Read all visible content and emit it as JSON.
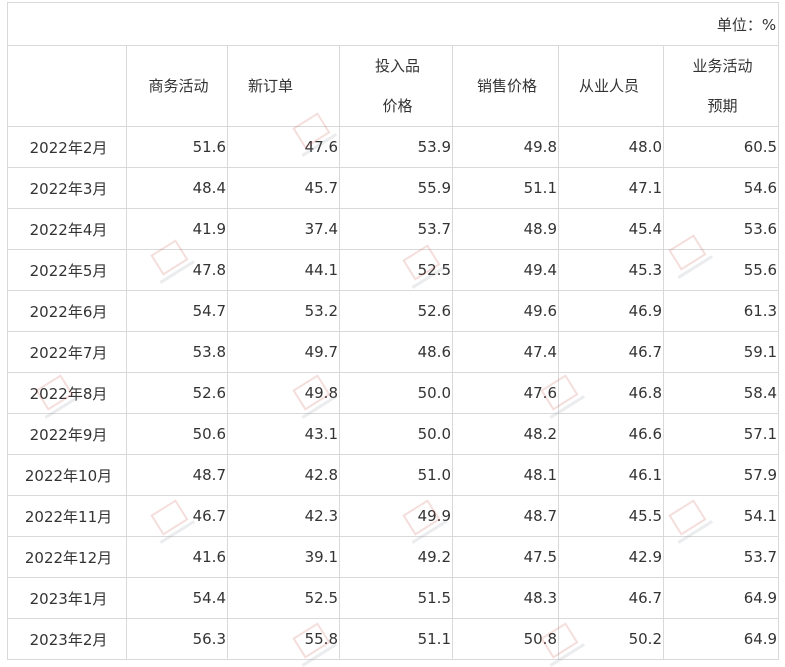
{
  "unit_label": "单位：%",
  "header": {
    "month": "",
    "business_activity": "商务活动",
    "new_orders": "新订单",
    "input_price_line1": "投入品",
    "input_price_line2": "价格",
    "sales_price": "销售价格",
    "employees": "从业人员",
    "expectation_line1": "业务活动",
    "expectation_line2": "预期"
  },
  "rows": [
    {
      "month": "2022年2月",
      "business_activity": "51.6",
      "new_orders": "47.6",
      "input_price": "53.9",
      "sales_price": "49.8",
      "employees": "48.0",
      "expectation": "60.5"
    },
    {
      "month": "2022年3月",
      "business_activity": "48.4",
      "new_orders": "45.7",
      "input_price": "55.9",
      "sales_price": "51.1",
      "employees": "47.1",
      "expectation": "54.6"
    },
    {
      "month": "2022年4月",
      "business_activity": "41.9",
      "new_orders": "37.4",
      "input_price": "53.7",
      "sales_price": "48.9",
      "employees": "45.4",
      "expectation": "53.6"
    },
    {
      "month": "2022年5月",
      "business_activity": "47.8",
      "new_orders": "44.1",
      "input_price": "52.5",
      "sales_price": "49.4",
      "employees": "45.3",
      "expectation": "55.6"
    },
    {
      "month": "2022年6月",
      "business_activity": "54.7",
      "new_orders": "53.2",
      "input_price": "52.6",
      "sales_price": "49.6",
      "employees": "46.9",
      "expectation": "61.3"
    },
    {
      "month": "2022年7月",
      "business_activity": "53.8",
      "new_orders": "49.7",
      "input_price": "48.6",
      "sales_price": "47.4",
      "employees": "46.7",
      "expectation": "59.1"
    },
    {
      "month": "2022年8月",
      "business_activity": "52.6",
      "new_orders": "49.8",
      "input_price": "50.0",
      "sales_price": "47.6",
      "employees": "46.8",
      "expectation": "58.4"
    },
    {
      "month": "2022年9月",
      "business_activity": "50.6",
      "new_orders": "43.1",
      "input_price": "50.0",
      "sales_price": "48.2",
      "employees": "46.6",
      "expectation": "57.1"
    },
    {
      "month": "2022年10月",
      "business_activity": "48.7",
      "new_orders": "42.8",
      "input_price": "51.0",
      "sales_price": "48.1",
      "employees": "46.1",
      "expectation": "57.9"
    },
    {
      "month": "2022年11月",
      "business_activity": "46.7",
      "new_orders": "42.3",
      "input_price": "49.9",
      "sales_price": "48.7",
      "employees": "45.5",
      "expectation": "54.1"
    },
    {
      "month": "2022年12月",
      "business_activity": "41.6",
      "new_orders": "39.1",
      "input_price": "49.2",
      "sales_price": "47.5",
      "employees": "42.9",
      "expectation": "53.7"
    },
    {
      "month": "2023年1月",
      "business_activity": "54.4",
      "new_orders": "52.5",
      "input_price": "51.5",
      "sales_price": "48.3",
      "employees": "46.7",
      "expectation": "64.9"
    },
    {
      "month": "2023年2月",
      "business_activity": "56.3",
      "new_orders": "55.8",
      "input_price": "51.1",
      "sales_price": "50.8",
      "employees": "50.2",
      "expectation": "64.9"
    }
  ]
}
